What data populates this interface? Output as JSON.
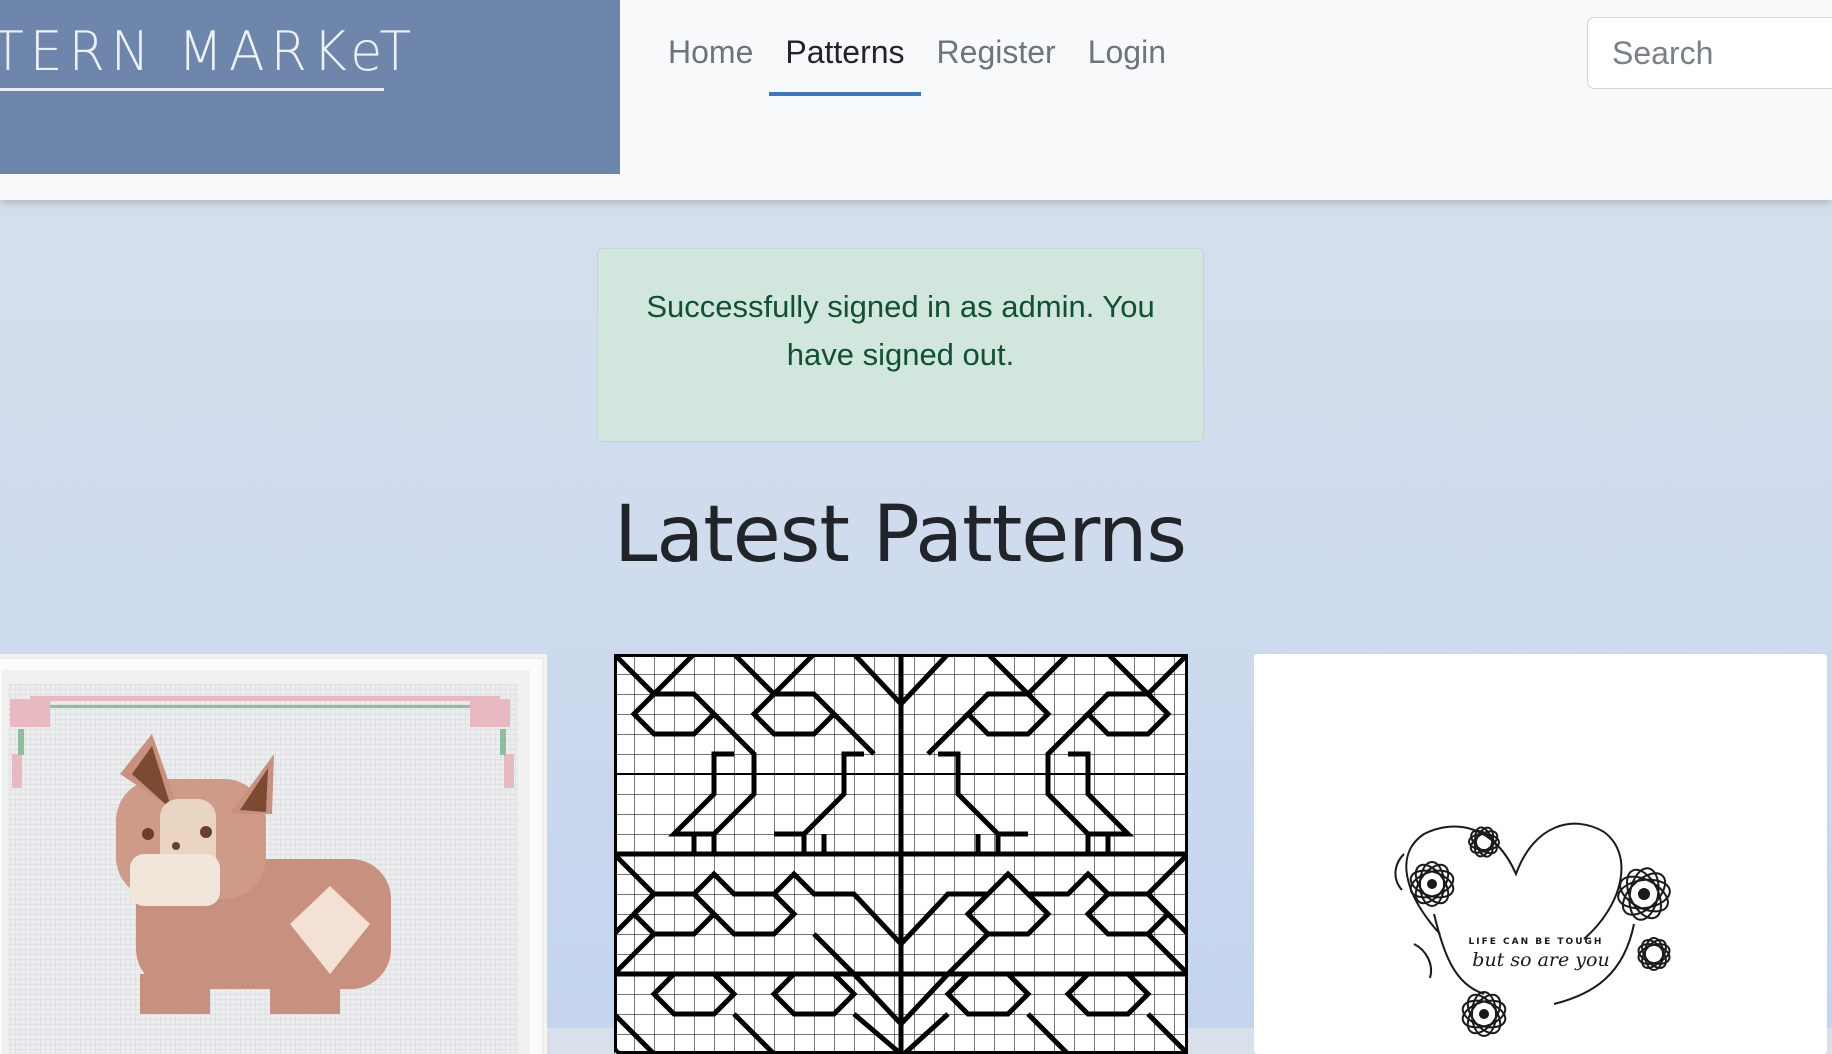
{
  "brand": {
    "logo_text": "TERN MARKeT"
  },
  "nav": {
    "items": [
      {
        "label": "Home",
        "active": false
      },
      {
        "label": "Patterns",
        "active": true
      },
      {
        "label": "Register",
        "active": false
      },
      {
        "label": "Login",
        "active": false
      }
    ],
    "accent_color": "#3d78c2"
  },
  "search": {
    "placeholder": "Search",
    "value": ""
  },
  "alert": {
    "message": "Successfully signed in as admin. You have signed out.",
    "type": "success"
  },
  "main": {
    "title": "Latest Patterns"
  },
  "patterns": [
    {
      "name": "corgi-cross-stitch"
    },
    {
      "name": "blackwork-birds-pattern"
    },
    {
      "name": "floral-heart-pattern",
      "caption_small": "LIFE CAN BE TOUGH",
      "caption_script": "but so are you"
    }
  ]
}
